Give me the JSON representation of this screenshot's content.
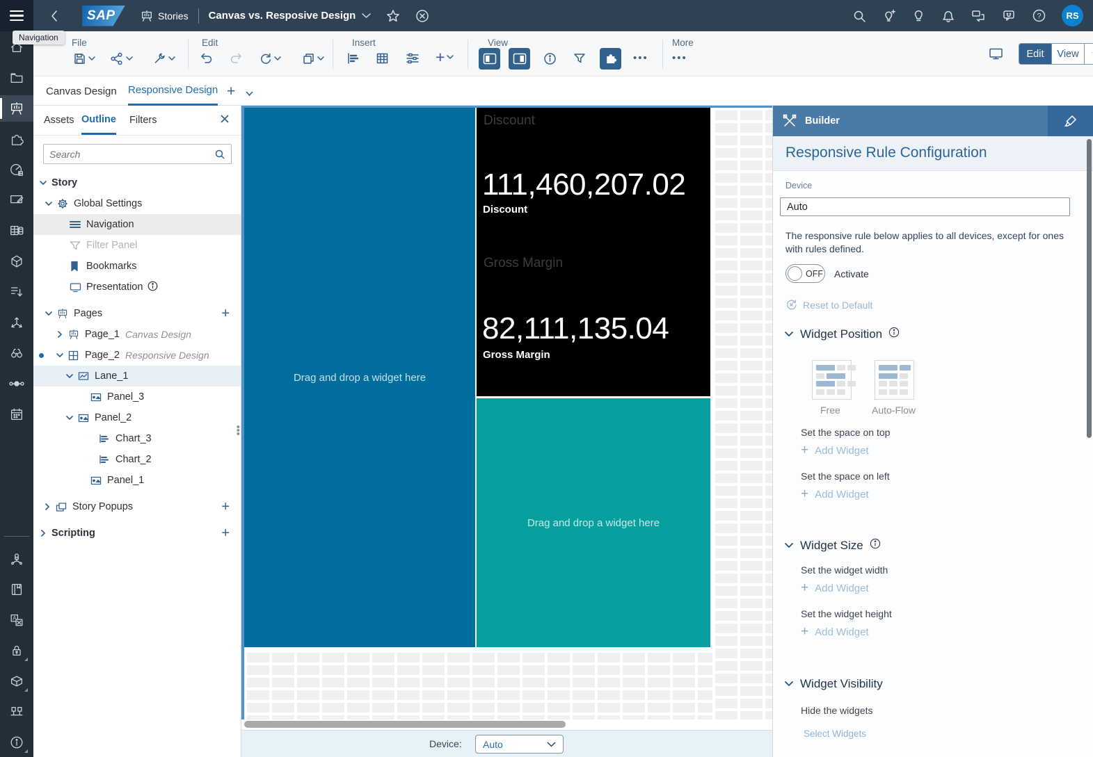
{
  "shell": {
    "stories_label": "Stories",
    "story_title": "Canvas vs. Resposive Design",
    "avatar_initials": "RS",
    "tooltip": "Navigation"
  },
  "toolbar": {
    "file": "File",
    "edit": "Edit",
    "insert": "Insert",
    "view": "View",
    "more": "More",
    "edit_btn": "Edit",
    "view_btn": "View"
  },
  "page_tabs": {
    "canvas": "Canvas Design",
    "responsive": "Responsive Design"
  },
  "outline": {
    "tab_assets": "Assets",
    "tab_outline": "Outline",
    "tab_filters": "Filters",
    "search_placeholder": "Search",
    "tree": [
      {
        "label": "Story",
        "icon": ""
      },
      {
        "label": "Global Settings",
        "icon": "gear-icon"
      },
      {
        "label": "Navigation",
        "icon": "menu-icon"
      },
      {
        "label": "Filter Panel",
        "icon": "funnel-icon"
      },
      {
        "label": "Bookmarks",
        "icon": "bookmark-icon"
      },
      {
        "label": "Presentation",
        "icon": "monitor-icon"
      },
      {
        "label": "Pages",
        "icon": "easel-icon"
      },
      {
        "label": "Page_1",
        "sublabel": "Canvas Design",
        "icon": "easel-icon"
      },
      {
        "label": "Page_2",
        "sublabel": "Responsive Design",
        "icon": "layout-grid-icon"
      },
      {
        "label": "Lane_1",
        "icon": "lane-icon"
      },
      {
        "label": "Panel_3",
        "icon": "panel-icon"
      },
      {
        "label": "Panel_2",
        "icon": "panel-icon"
      },
      {
        "label": "Chart_3",
        "icon": "bar-chart-icon"
      },
      {
        "label": "Chart_2",
        "icon": "bar-chart-icon"
      },
      {
        "label": "Panel_1",
        "icon": "panel-icon"
      },
      {
        "label": "Story Popups",
        "icon": "popup-icon"
      },
      {
        "label": "Scripting",
        "icon": ""
      }
    ]
  },
  "canvas": {
    "drag_text_blue": "Drag and drop a widget here",
    "drag_text_teal": "Drag and drop a widget here",
    "kpi_discount": {
      "ghost_title": "Discount",
      "value": "111,460,207.02",
      "label": "Discount"
    },
    "kpi_gross": {
      "ghost_title": "Gross Margin",
      "value": "82,111,135.04",
      "label": "Gross Margin"
    },
    "colors": {
      "lane_blue": "#016e9e",
      "teal": "#06a09e",
      "black": "#000000"
    }
  },
  "footer": {
    "device_label": "Device:",
    "device_value": "Auto"
  },
  "builder": {
    "title": "Builder",
    "heading": "Responsive Rule Configuration",
    "device_label": "Device",
    "device_value": "Auto",
    "description": "The responsive rule below applies to all devices, except for ones with rules defined.",
    "toggle_off": "OFF",
    "activate": "Activate",
    "reset": "Reset to Default",
    "position": {
      "title": "Widget Position",
      "free": "Free",
      "autoflow": "Auto-Flow",
      "space_top": "Set the space on top",
      "space_left": "Set the space on left",
      "add_widget": "Add Widget"
    },
    "size": {
      "title": "Widget Size",
      "width": "Set the widget width",
      "height": "Set the widget height",
      "add_widget": "Add Widget"
    },
    "visibility": {
      "title": "Widget Visibility",
      "hide": "Hide the widgets",
      "select": "Select Widgets"
    }
  }
}
